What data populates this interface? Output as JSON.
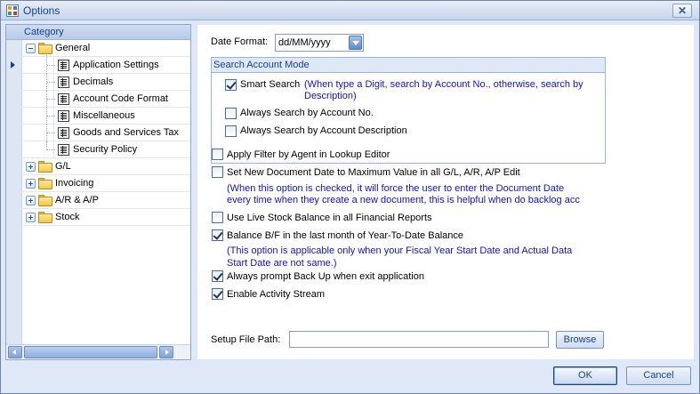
{
  "window": {
    "title": "Options",
    "close_label": "✕"
  },
  "category": {
    "header": "Category",
    "tree": [
      {
        "label": "General",
        "expanded": true,
        "children": [
          "Application Settings",
          "Decimals",
          "Account Code Format",
          "Miscellaneous",
          "Goods and Services Tax",
          "Security Policy"
        ]
      },
      {
        "label": "G/L",
        "expanded": false
      },
      {
        "label": "Invoicing",
        "expanded": false
      },
      {
        "label": "A/R & A/P",
        "expanded": false
      },
      {
        "label": "Stock",
        "expanded": false
      }
    ],
    "selected": "Application Settings"
  },
  "settings": {
    "date_format_label": "Date Format:",
    "date_format_value": "dd/MM/yyyy",
    "search_mode": {
      "title": "Search Account Mode",
      "options": [
        {
          "label": "Smart Search",
          "checked": true,
          "note_line1": "(When type a Digit, search by Account No., otherwise, search by",
          "note_line2": "Description)"
        },
        {
          "label": "Always Search by Account No.",
          "checked": false
        },
        {
          "label": "Always Search by Account Description",
          "checked": false
        }
      ]
    },
    "apply_filter": {
      "label": "Apply Filter by Agent in Lookup Editor",
      "checked": false
    },
    "new_doc_date": {
      "label": "Set New Document Date to Maximum Value in all G/L, A/R, A/P Edit",
      "checked": false,
      "note_line1": "(When this option is checked, it will force the user to enter the Document Date",
      "note_line2": "every time when they create a new document, this is helpful when do backlog acc"
    },
    "live_stock": {
      "label": "Use Live Stock Balance in all Financial Reports",
      "checked": false
    },
    "balance_bf": {
      "label": "Balance B/F in the last month of Year-To-Date Balance",
      "checked": true,
      "note_line1": "(This option is applicable only when your Fiscal Year Start Date and Actual Data",
      "note_line2": "Start Date are not same.)"
    },
    "backup_prompt": {
      "label": "Always prompt Back Up when exit application",
      "checked": true
    },
    "activity_stream": {
      "label": "Enable Activity Stream",
      "checked": true
    },
    "setup_path_label": "Setup File Path:",
    "setup_path_value": "",
    "browse_label": "Browse"
  },
  "footer": {
    "ok_label": "OK",
    "cancel_label": "Cancel"
  },
  "colors": {
    "accent": "#15428b",
    "note": "#1111bb",
    "panel": "#dfe8f6"
  }
}
